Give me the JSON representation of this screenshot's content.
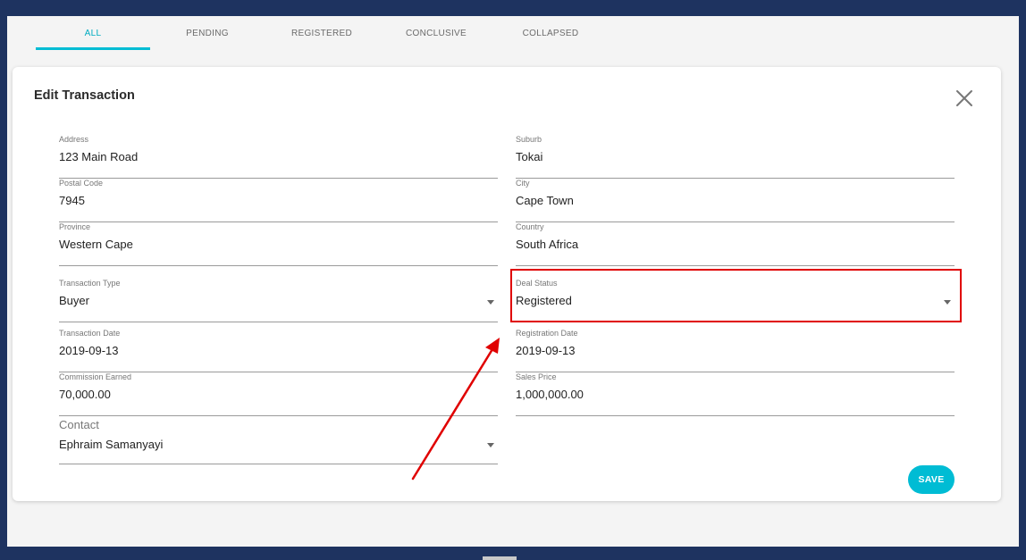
{
  "tabs": [
    {
      "label": "ALL",
      "active": true
    },
    {
      "label": "PENDING",
      "active": false
    },
    {
      "label": "REGISTERED",
      "active": false
    },
    {
      "label": "CONCLUSIVE",
      "active": false
    },
    {
      "label": "COLLAPSED",
      "active": false
    }
  ],
  "dialog": {
    "title": "Edit Transaction",
    "close_icon": "close-icon",
    "save_label": "SAVE"
  },
  "fields": {
    "address": {
      "label": "Address",
      "value": "123 Main Road"
    },
    "suburb": {
      "label": "Suburb",
      "value": "Tokai"
    },
    "postal_code": {
      "label": "Postal Code",
      "value": "7945"
    },
    "city": {
      "label": "City",
      "value": "Cape Town"
    },
    "province": {
      "label": "Province",
      "value": "Western Cape"
    },
    "country": {
      "label": "Country",
      "value": "South Africa"
    },
    "transaction_type": {
      "label": "Transaction Type",
      "value": "Buyer"
    },
    "deal_status": {
      "label": "Deal Status",
      "value": "Registered"
    },
    "transaction_date": {
      "label": "Transaction Date",
      "value": "2019-09-13"
    },
    "registration_date": {
      "label": "Registration Date",
      "value": "2019-09-13"
    },
    "commission_earned": {
      "label": "Commission Earned",
      "value": "70,000.00"
    },
    "sales_price": {
      "label": "Sales Price",
      "value": "1,000,000.00"
    },
    "contact": {
      "label": "Contact",
      "value": "Ephraim Samanyayi"
    }
  },
  "colors": {
    "accent": "#00bcd4",
    "frame": "#1e3360",
    "annotation": "#e00000"
  }
}
